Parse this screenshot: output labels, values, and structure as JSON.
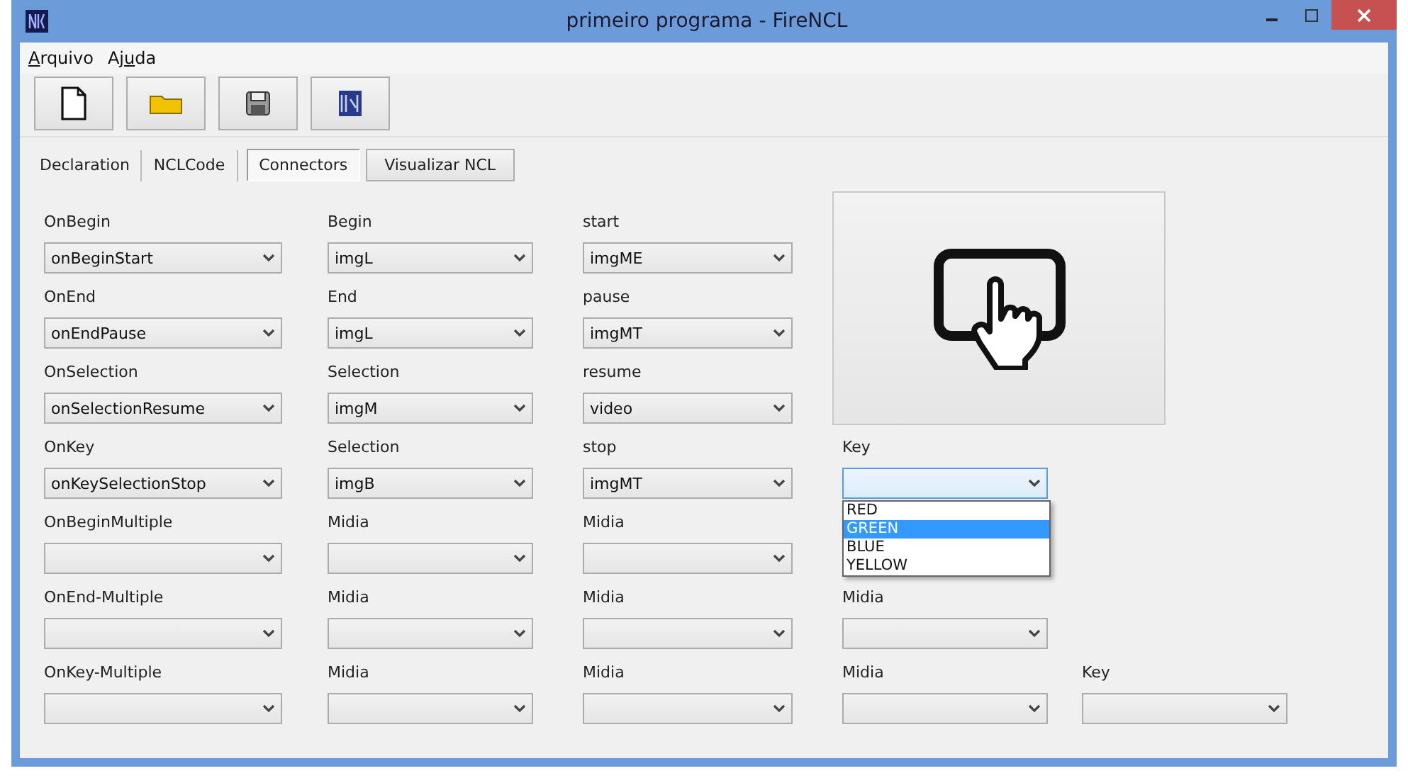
{
  "window": {
    "title": "primeiro programa - FireNCL"
  },
  "menu": [
    {
      "access_key": "A",
      "after": "rquivo"
    },
    {
      "before": "Aj",
      "access_key": "u",
      "after": "da"
    }
  ],
  "toolbar": [
    {
      "kind": "new"
    },
    {
      "kind": "open"
    },
    {
      "kind": "save"
    },
    {
      "kind": "ncl"
    }
  ],
  "tabs": [
    {
      "label": "Declaration",
      "selected": false
    },
    {
      "label": "NCLCode",
      "selected": false
    },
    {
      "label": "Connectors",
      "selected": true
    }
  ],
  "view_button": {
    "label": "Visualizar NCL"
  },
  "rows": [
    {
      "fields": [
        {
          "label": "OnBegin",
          "value": "onBeginStart",
          "open": false
        },
        {
          "label": "Begin",
          "value": "imgL",
          "open": false
        },
        {
          "label": "start",
          "value": "imgME",
          "open": false
        }
      ]
    },
    {
      "fields": [
        {
          "label": "OnEnd",
          "value": "onEndPause",
          "open": false
        },
        {
          "label": "End",
          "value": "imgL",
          "open": false
        },
        {
          "label": "pause",
          "value": "imgMT",
          "open": false
        }
      ]
    },
    {
      "fields": [
        {
          "label": "OnSelection",
          "value": "onSelectionResume",
          "open": false
        },
        {
          "label": "Selection",
          "value": "imgM",
          "open": false
        },
        {
          "label": "resume",
          "value": "video",
          "open": false
        }
      ]
    },
    {
      "fields": [
        {
          "label": "OnKey",
          "value": "onKeySelectionStop",
          "open": false
        },
        {
          "label": "Selection",
          "value": "imgB",
          "open": false
        },
        {
          "label": "stop",
          "value": "imgMT",
          "open": false
        },
        {
          "label": "Key",
          "open": true,
          "options": [
            {
              "label": "RED",
              "selected": false
            },
            {
              "label": "GREEN",
              "selected": true
            },
            {
              "label": "BLUE",
              "selected": false
            },
            {
              "label": "YELLOW",
              "selected": false
            }
          ]
        }
      ]
    },
    {
      "fields": [
        {
          "label": "OnBeginMultiple",
          "open": false
        },
        {
          "label": "Midia",
          "open": false
        },
        {
          "label": "Midia",
          "open": false
        }
      ]
    },
    {
      "fields": [
        {
          "label": "OnEnd-Multiple",
          "open": false
        },
        {
          "label": "Midia",
          "open": false
        },
        {
          "label": "Midia",
          "open": false
        },
        {
          "label": "Midia",
          "open": false
        }
      ]
    },
    {
      "fields": [
        {
          "label": "OnKey-Multiple",
          "open": false
        },
        {
          "label": "Midia",
          "open": false
        },
        {
          "label": "Midia",
          "open": false
        },
        {
          "label": "Midia",
          "open": false
        },
        {
          "label": "Key",
          "open": false
        }
      ]
    }
  ]
}
